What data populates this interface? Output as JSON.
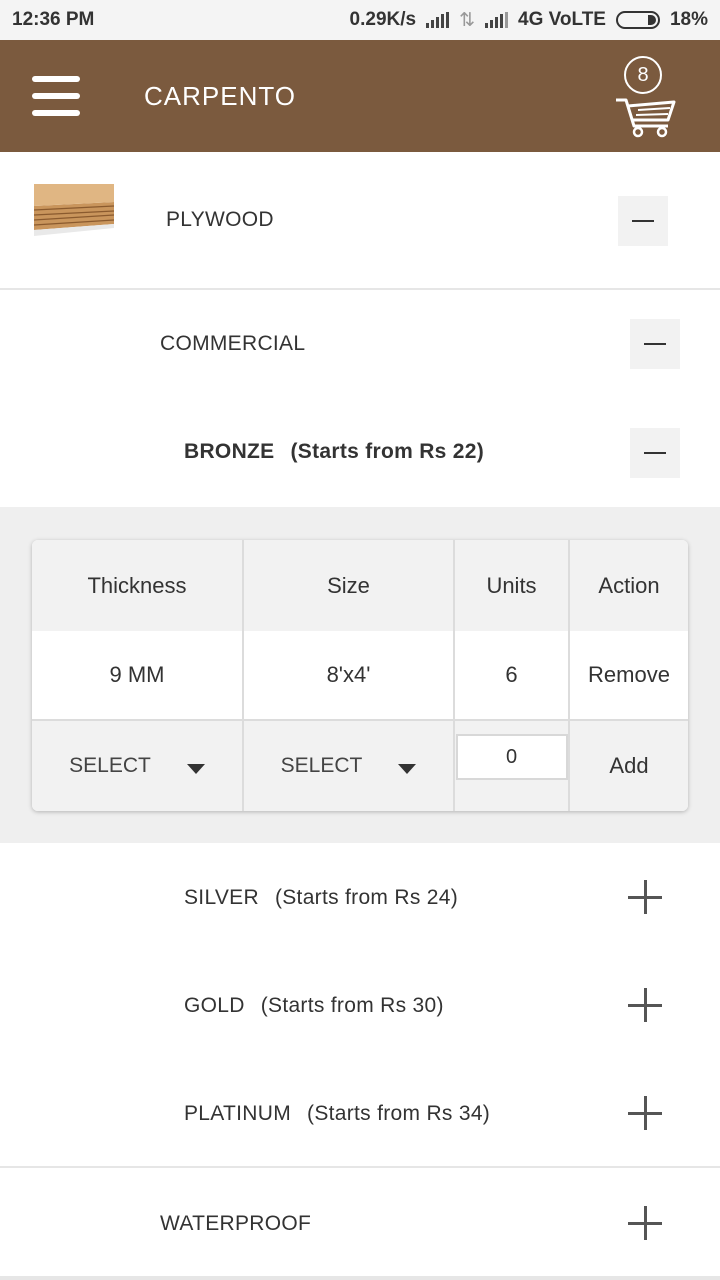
{
  "status_bar": {
    "time": "12:36 PM",
    "speed": "0.29K/s",
    "network": "4G VoLTE",
    "battery": "18%"
  },
  "app_bar": {
    "title": "CARPENTO",
    "cart_count": "8",
    "color": "#7b5a3e"
  },
  "category": {
    "name": "PLYWOOD"
  },
  "subcategory": {
    "name": "COMMERCIAL"
  },
  "grade_open": {
    "name": "BRONZE",
    "price_note": "(Starts from Rs 22)"
  },
  "table": {
    "headers": [
      "Thickness",
      "Size",
      "Units",
      "Action"
    ],
    "row": {
      "thickness": "9 MM",
      "size": "8'x4'",
      "units": "6",
      "action": "Remove"
    },
    "input_row": {
      "thickness_select": "SELECT",
      "size_select": "SELECT",
      "units_value": "0",
      "action": "Add"
    }
  },
  "grades_collapsed": [
    {
      "name": "SILVER",
      "price_note": "(Starts from Rs 24)"
    },
    {
      "name": "GOLD",
      "price_note": "(Starts from Rs 30)"
    },
    {
      "name": "PLATINUM",
      "price_note": "(Starts from Rs 34)"
    }
  ],
  "other_subcategory": {
    "name": "WATERPROOF"
  }
}
